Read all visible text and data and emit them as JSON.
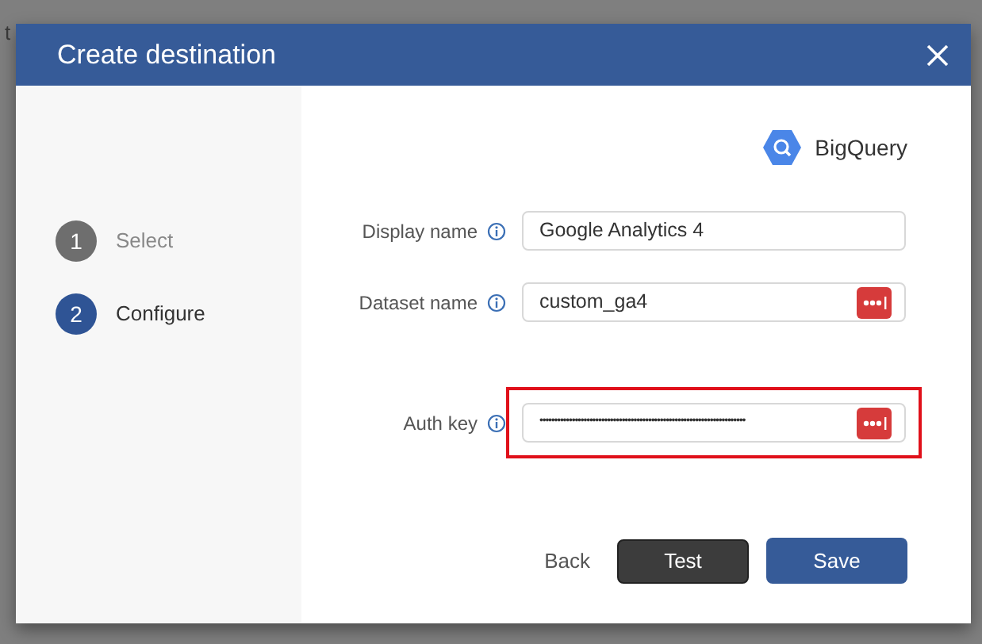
{
  "background_text": "t",
  "dialog": {
    "title": "Create destination",
    "steps": [
      {
        "number": "1",
        "label": "Select",
        "selected": false
      },
      {
        "number": "2",
        "label": "Configure",
        "selected": true
      }
    ],
    "destination": "BigQuery",
    "fields": [
      {
        "label": "Display name",
        "value": "Google Analytics 4",
        "password_manager": false,
        "highlighted": false,
        "masked": false
      },
      {
        "label": "Dataset name",
        "value": "custom_ga4",
        "password_manager": true,
        "highlighted": false,
        "masked": false
      },
      {
        "label": "Auth key",
        "value": "••••••••••••••••••••••••••••••••••••••••••••••••••••••••••••••••••••••",
        "password_manager": true,
        "highlighted": true,
        "masked": true
      }
    ],
    "buttons": [
      {
        "label": "Back",
        "kind": "link"
      },
      {
        "label": "Test",
        "kind": "dark"
      },
      {
        "label": "Save",
        "kind": "primary"
      }
    ]
  }
}
